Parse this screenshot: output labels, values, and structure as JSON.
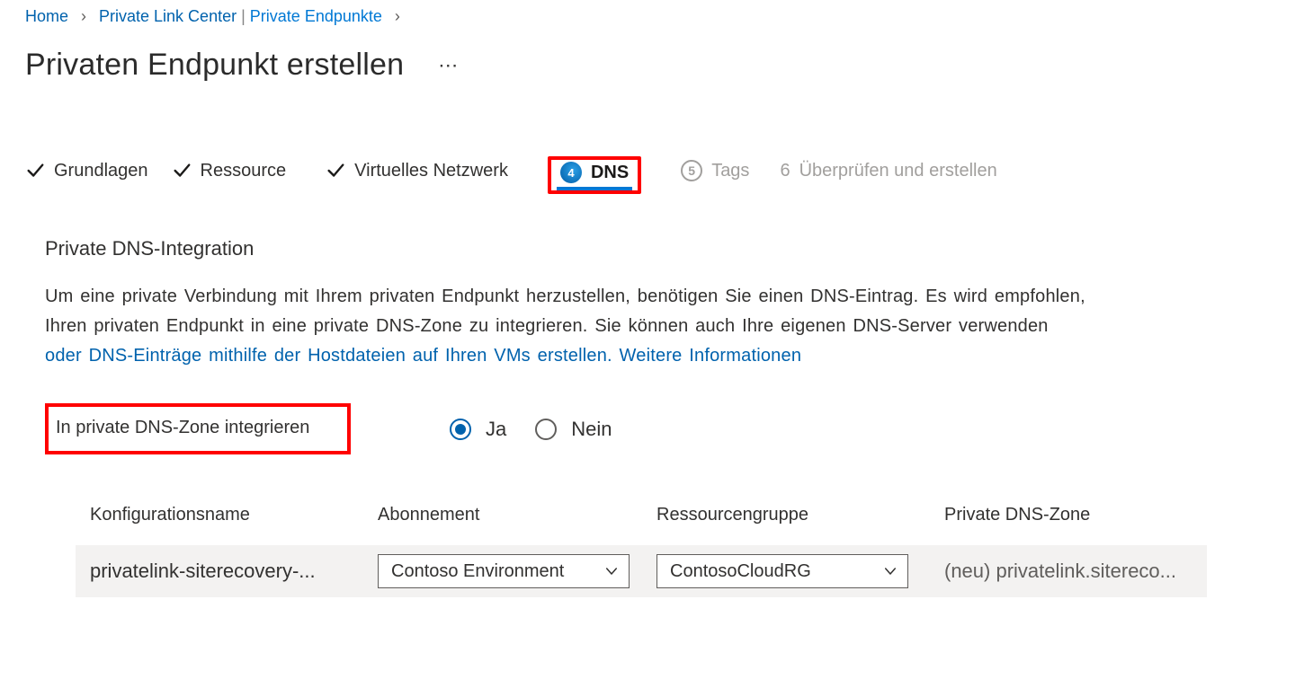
{
  "breadcrumb": {
    "home": "Home",
    "center": "Private Link Center",
    "sub": "Private Endpunkte"
  },
  "title": "Privaten Endpunkt erstellen",
  "wizard": {
    "step1": "Grundlagen",
    "step2": "Ressource",
    "step3": "Virtuelles Netzwerk",
    "step4_num": "4",
    "step4": "DNS",
    "step5_num": "5",
    "step5": "Tags",
    "step6_num": "6",
    "step6": "Überprüfen und erstellen"
  },
  "dns_section": {
    "heading": "Private DNS-Integration",
    "line1": "Um eine private Verbindung mit Ihrem privaten Endpunkt herzustellen, benötigen Sie einen DNS-Eintrag. Es wird empfohlen,",
    "line2": "Ihren privaten Endpunkt in eine private DNS-Zone zu integrieren. Sie können auch Ihre eigenen DNS-Server verwenden",
    "line3_link": "oder DNS-Einträge mithilfe der Hostdateien auf Ihren VMs erstellen. Weitere Informationen",
    "integrate_label": "In private DNS-Zone integrieren",
    "yes": "Ja",
    "no": "Nein"
  },
  "table": {
    "headers": {
      "config": "Konfigurationsname",
      "subscription": "Abonnement",
      "rg": "Ressourcengruppe",
      "zone": "Private DNS-Zone"
    },
    "row": {
      "config": "privatelink-siterecovery-...",
      "subscription": "Contoso Environment",
      "rg": "ContosoCloudRG",
      "zone": "(neu) privatelink.sitereco..."
    }
  }
}
